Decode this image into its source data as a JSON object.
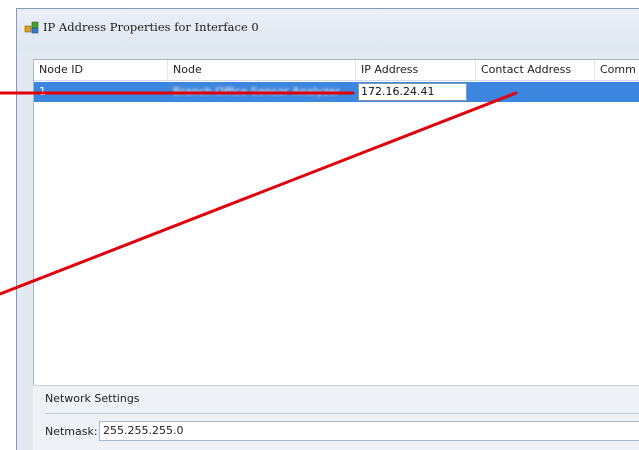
{
  "window": {
    "title": "IP Address Properties for Interface 0"
  },
  "table": {
    "columns": [
      {
        "key": "node_id",
        "label": "Node ID"
      },
      {
        "key": "node",
        "label": "Node"
      },
      {
        "key": "ip_address",
        "label": "IP Address"
      },
      {
        "key": "contact_address",
        "label": "Contact Address"
      },
      {
        "key": "comment",
        "label": "Comm"
      }
    ],
    "rows": [
      {
        "node_id": "1",
        "node": "Branch Office Sensor Analyzer",
        "ip_address": "172.16.24.41",
        "contact_address": "",
        "comment": "",
        "selected": true
      }
    ]
  },
  "network_settings": {
    "title": "Network Settings",
    "netmask_label": "Netmask:",
    "netmask_value": "255.255.255.0"
  },
  "colors": {
    "selection": "#3d86df",
    "annotation_lines": "#e0000b"
  }
}
